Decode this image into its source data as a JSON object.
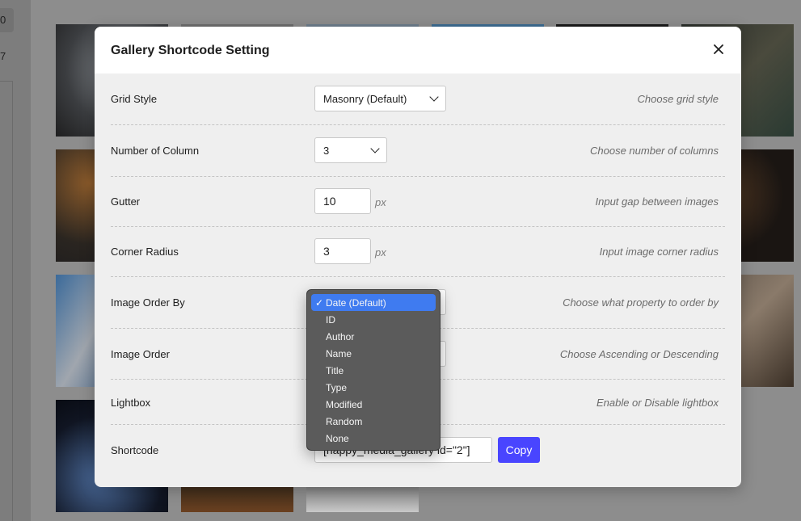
{
  "background": {
    "sidebar_numbers": [
      "0",
      "7"
    ]
  },
  "modal": {
    "title": "Gallery Shortcode Setting",
    "close_icon": "close-icon",
    "rows": {
      "grid_style": {
        "label": "Grid Style",
        "value": "Masonry (Default)",
        "hint": "Choose grid style"
      },
      "columns": {
        "label": "Number of Column",
        "value": "3",
        "hint": "Choose number of columns"
      },
      "gutter": {
        "label": "Gutter",
        "value": "10",
        "unit": "px",
        "hint": "Input gap between images"
      },
      "corner_radius": {
        "label": "Corner Radius",
        "value": "3",
        "unit": "px",
        "hint": "Input image corner radius"
      },
      "order_by": {
        "label": "Image Order By",
        "hint": "Choose what property to order by"
      },
      "order": {
        "label": "Image Order",
        "hint": "Choose Ascending or Descending"
      },
      "lightbox": {
        "label": "Lightbox",
        "hint": "Enable or Disable lightbox"
      },
      "shortcode": {
        "label": "Shortcode",
        "value": "[happy_media_gallery id=\"2\"]",
        "copy_label": "Copy"
      }
    }
  },
  "order_by_menu": {
    "check": "✓",
    "options": [
      "Date (Default)",
      "ID",
      "Author",
      "Name",
      "Title",
      "Type",
      "Modified",
      "Random",
      "None"
    ],
    "selected": "Date (Default)"
  },
  "colors": {
    "accent": "#4945ff",
    "menu_selected": "#3f7bf0",
    "menu_bg": "#5b5b5b"
  }
}
